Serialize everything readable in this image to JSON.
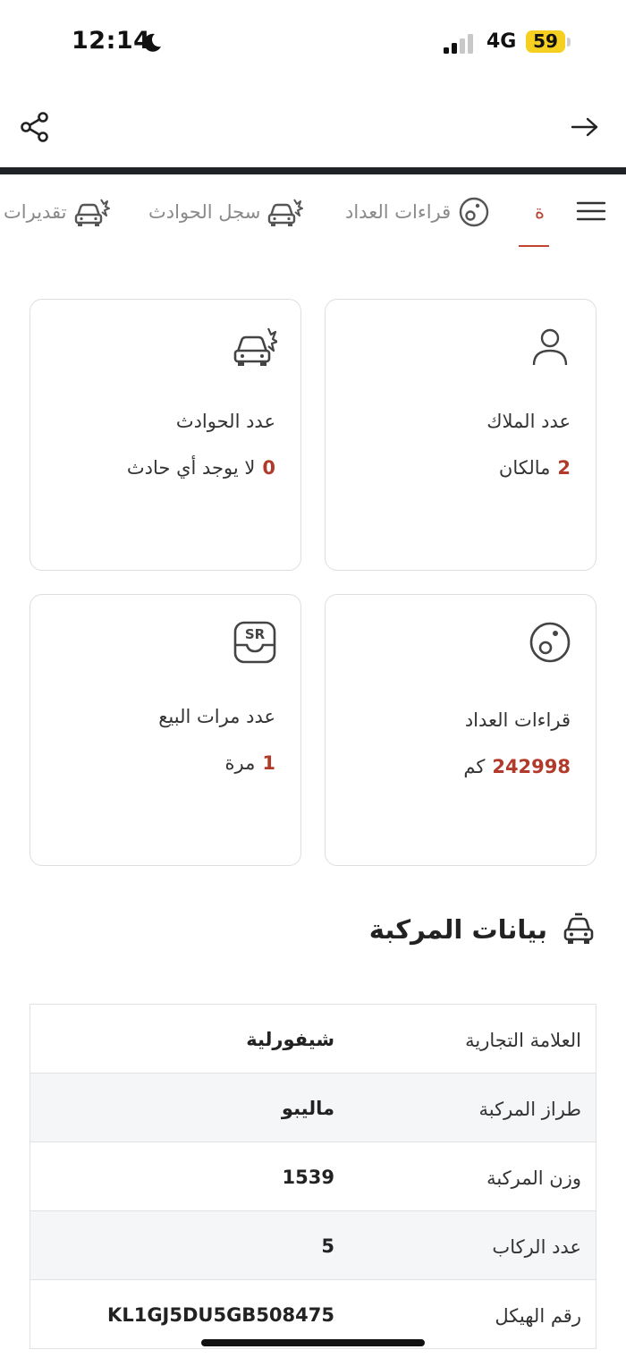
{
  "status_bar": {
    "time": "12:14",
    "network": "4G",
    "battery": "59"
  },
  "tabs": [
    {
      "label": "ة",
      "active": true
    },
    {
      "label": "قراءات العداد",
      "active": false
    },
    {
      "label": "سجل الحوادث",
      "active": false
    },
    {
      "label": "تقديرات",
      "active": false
    }
  ],
  "cards": {
    "owners": {
      "label": "عدد الملاك",
      "value": "2",
      "unit": "مالكان"
    },
    "accidents": {
      "label": "عدد الحوادث",
      "value": "0",
      "unit": "لا يوجد أي حادث"
    },
    "odometer": {
      "label": "قراءات العداد",
      "value": "242998",
      "unit": "كم"
    },
    "sales": {
      "label": "عدد مرات البيع",
      "value": "1",
      "unit": "مرة",
      "badge": "SR"
    }
  },
  "vehicle_section": {
    "title": "بيانات المركبة",
    "rows": [
      {
        "label": "العلامة التجارية",
        "value": "شيفورلية"
      },
      {
        "label": "طراز المركبة",
        "value": "ماليبو"
      },
      {
        "label": "وزن المركبة",
        "value": "1539"
      },
      {
        "label": "عدد الركاب",
        "value": "5"
      },
      {
        "label": "رقم الهيكل",
        "value": "KL1GJ5DU5GB508475"
      }
    ]
  }
}
